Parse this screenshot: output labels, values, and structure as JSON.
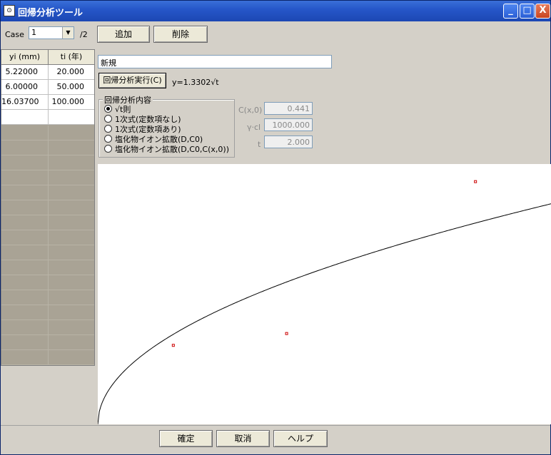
{
  "window": {
    "title": "回帰分析ツール",
    "icon": "app-icon",
    "min_glyph": "_",
    "max_glyph": "□",
    "close_glyph": "X"
  },
  "toolbar": {
    "case_label": "Case",
    "case_value": "1",
    "case_total": "/2",
    "add_label": "追加",
    "delete_label": "削除"
  },
  "table": {
    "headers": [
      "yi (mm)",
      "ti (年)"
    ],
    "rows": [
      [
        "5.22000",
        "20.000"
      ],
      [
        "6.00000",
        "50.000"
      ],
      [
        "16.03700",
        "100.000"
      ],
      [
        "",
        ""
      ]
    ]
  },
  "name_field": "新規",
  "run_button_label": "回帰分析実行(C)",
  "result_text": "y=1.3302√t",
  "analysis_group": {
    "title": "回帰分析内容",
    "options": [
      "√t則",
      "1次式(定数項なし)",
      "1次式(定数項あり)",
      "塩化物イオン拡散(D,C0)",
      "塩化物イオン拡散(D,C0,C(x,0))"
    ],
    "selected_index": 0
  },
  "params": [
    {
      "label": "C(x,0)",
      "value": "0.441"
    },
    {
      "label": "γ·cl",
      "value": "1000.000"
    },
    {
      "label": "t",
      "value": "2.000"
    }
  ],
  "chart_data": {
    "type": "scatter",
    "points": [
      {
        "x": 20,
        "y": 5.22
      },
      {
        "x": 50,
        "y": 6.0
      },
      {
        "x": 100,
        "y": 16.037
      }
    ],
    "curve": {
      "equation": "y=1.3302√t",
      "coefficient": 1.3302
    },
    "xlim": [
      0,
      120
    ],
    "ylim": [
      0,
      17.2
    ],
    "point_color": "#cc0000",
    "line_color": "#000000"
  },
  "footer": {
    "ok_label": "確定",
    "cancel_label": "取消",
    "help_label": "ヘルプ"
  }
}
